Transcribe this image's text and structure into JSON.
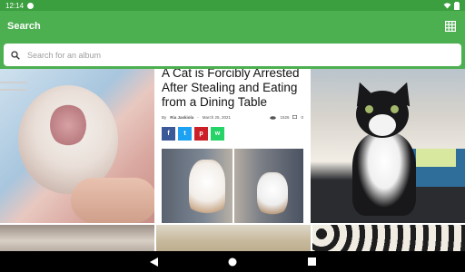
{
  "statusbar": {
    "time": "12:14"
  },
  "appbar": {
    "title": "Search"
  },
  "search": {
    "placeholder": "Search for an album"
  },
  "article": {
    "headline": "A Cat is Forcibly Arrested After Stealing and Eating from a Dining Table",
    "author": "Ria Jaskiola",
    "date": "March 25, 2021",
    "views": "1526",
    "comments": "0",
    "share_labels": [
      "f",
      "t",
      "p",
      "w"
    ]
  },
  "colors": {
    "appbar": "#4caf50",
    "statusbar": "#3b9e3f",
    "navbar": "#000000",
    "facebook": "#3b5998",
    "twitter": "#1da1f2",
    "pinterest": "#cb2027",
    "whatsapp": "#25d366"
  },
  "icons": {
    "grid": "grid-view-icon",
    "search": "search-icon",
    "back": "back-triangle-icon",
    "home": "home-circle-icon",
    "recents": "recents-square-icon"
  }
}
